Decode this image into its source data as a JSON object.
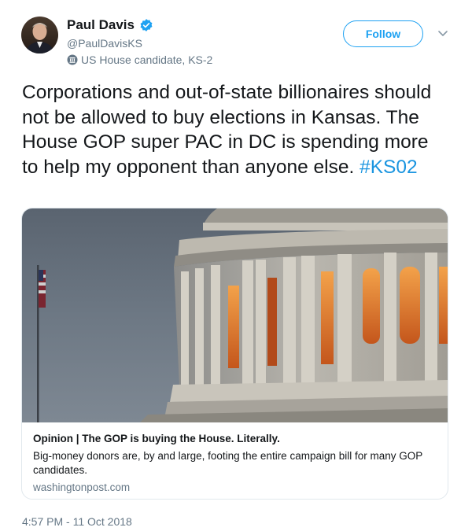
{
  "user": {
    "display_name": "Paul Davis",
    "handle": "@PaulDavisKS",
    "label": "US House candidate, KS-2"
  },
  "follow": {
    "label": "Follow"
  },
  "tweet": {
    "text": "Corporations and out-of-state billionaires should not be allowed to buy elections in Kansas. The House GOP super PAC in DC is spending more to help my opponent than anyone else.",
    "hashtag": "#KS02"
  },
  "card": {
    "title": "Opinion | The GOP is buying the House. Literally.",
    "description": "Big-money donors are, by and large, footing the entire campaign bill for many GOP candidates.",
    "domain": "washingtonpost.com"
  },
  "timestamp": "4:57 PM - 11 Oct 2018",
  "colors": {
    "accent": "#1da1f2",
    "hashtag": "#1b95e0",
    "muted": "#657786",
    "border": "#e1e8ed"
  },
  "icons": {
    "verified": "verified-badge-icon",
    "government_label": "government-building-icon",
    "caret": "chevron-down-icon"
  }
}
